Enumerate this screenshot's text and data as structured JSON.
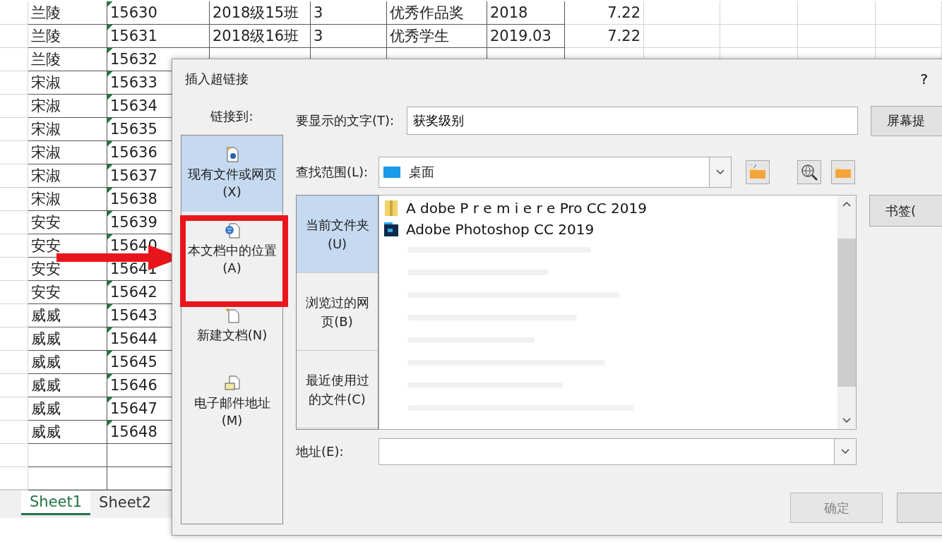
{
  "sheet": {
    "rows": [
      {
        "name": "兰陵",
        "id": "15630",
        "class": "2018级15班",
        "grade": "3",
        "award": "优秀作品奖",
        "date": "2018",
        "score": "7.22"
      },
      {
        "name": "兰陵",
        "id": "15631",
        "class": "2018级16班",
        "grade": "3",
        "award": "优秀学生",
        "date": "2019.03",
        "score": "7.22"
      },
      {
        "name": "兰陵",
        "id": "15632"
      },
      {
        "name": "宋淑",
        "id": "15633"
      },
      {
        "name": "宋淑",
        "id": "15634"
      },
      {
        "name": "宋淑",
        "id": "15635"
      },
      {
        "name": "宋淑",
        "id": "15636"
      },
      {
        "name": "宋淑",
        "id": "15637"
      },
      {
        "name": "宋淑",
        "id": "15638"
      },
      {
        "name": "安安",
        "id": "15639"
      },
      {
        "name": "安安",
        "id": "15640"
      },
      {
        "name": "安安",
        "id": "15641"
      },
      {
        "name": "安安",
        "id": "15642"
      },
      {
        "name": "威威",
        "id": "15643"
      },
      {
        "name": "威威",
        "id": "15644"
      },
      {
        "name": "威威",
        "id": "15645"
      },
      {
        "name": "威威",
        "id": "15646"
      },
      {
        "name": "威威",
        "id": "15647"
      },
      {
        "name": "威威",
        "id": "15648"
      }
    ],
    "tabs": [
      {
        "label": "Sheet1",
        "selected": true
      },
      {
        "label": "Sheet2",
        "selected": false
      }
    ]
  },
  "dialog": {
    "title": "插入超链接",
    "help": "?",
    "link_to_label": "链接到:",
    "link_types": [
      {
        "label": "现有文件或网页(X)",
        "kind": "web",
        "selected": true
      },
      {
        "label": "本文档中的位置(A)",
        "kind": "place",
        "selected": false
      },
      {
        "label": "新建文档(N)",
        "kind": "new",
        "selected": false
      },
      {
        "label": "电子邮件地址(M)",
        "kind": "mail",
        "selected": false
      }
    ],
    "display_text": {
      "label": "要显示的文字(T):",
      "value": "获奖级别"
    },
    "screen_tip_button": "屏幕提",
    "look_in": {
      "label": "查找范围(L):",
      "value": "桌面"
    },
    "browse_tabs": [
      {
        "label": "当前文件夹(U)",
        "selected": true
      },
      {
        "label": "浏览过的网页(B)",
        "selected": false
      },
      {
        "label": "最近使用过的文件(C)",
        "selected": false
      }
    ],
    "files": [
      {
        "name": "A dobe P r e m i e r e Pro CC 2019",
        "kind": "zip"
      },
      {
        "name": "Adobe Photoshop CC 2019",
        "kind": "ps"
      }
    ],
    "bookmark_button": "书签(",
    "address": {
      "label": "地址(E):"
    },
    "ok_button": {
      "label": "确定",
      "disabled": true
    }
  }
}
